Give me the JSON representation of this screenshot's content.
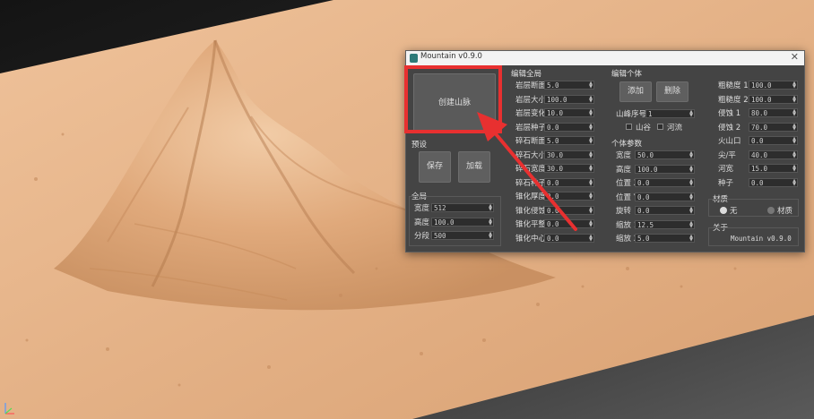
{
  "window": {
    "title": "Mountain v0.9.0",
    "close_glyph": "✕",
    "app_icon": "3ds-max-icon"
  },
  "create_button": {
    "label": "创建山脉"
  },
  "preset": {
    "header": "预设",
    "save_label": "保存",
    "load_label": "加载"
  },
  "global": {
    "header": "全局",
    "fields": [
      {
        "label": "宽度",
        "value": "512"
      },
      {
        "label": "高度",
        "value": "100.0"
      },
      {
        "label": "分段",
        "value": "500"
      }
    ]
  },
  "edit_global": {
    "header": "编辑全局",
    "fields": [
      {
        "label": "岩层断面",
        "value": "5.0"
      },
      {
        "label": "岩层大小",
        "value": "100.0"
      },
      {
        "label": "岩层变化",
        "value": "10.0"
      },
      {
        "label": "岩层种子",
        "value": "0.0"
      },
      {
        "label": "碎石断面",
        "value": "5.0"
      },
      {
        "label": "碎石大小",
        "value": "30.0"
      },
      {
        "label": "碎石宽度",
        "value": "30.0"
      },
      {
        "label": "碎石种子",
        "value": "0.0"
      },
      {
        "label": "锥化厚度",
        "value": "0.0"
      },
      {
        "label": "锥化侵蚀",
        "value": "0.0"
      },
      {
        "label": "锥化平整",
        "value": "0.0"
      },
      {
        "label": "锥化中心",
        "value": "0.0"
      }
    ]
  },
  "edit_individual": {
    "header": "编辑个体",
    "add_label": "添加",
    "delete_label": "删除",
    "peak_index_label": "山峰序号",
    "peak_index_value": "1",
    "valley_label": "山谷",
    "river_label": "河流"
  },
  "individual_params": {
    "header": "个体参数",
    "fields": [
      {
        "label": "宽度",
        "value": "50.0"
      },
      {
        "label": "高度",
        "value": "100.0"
      },
      {
        "label": "位置 X",
        "value": "0.0"
      },
      {
        "label": "位置 Y",
        "value": "0.0"
      },
      {
        "label": "旋转",
        "value": "0.0"
      },
      {
        "label": "缩放 1",
        "value": "12.5"
      },
      {
        "label": "缩放 2",
        "value": "5.0"
      }
    ]
  },
  "right_params": {
    "fields": [
      {
        "label": "粗糙度 1",
        "value": "100.0"
      },
      {
        "label": "粗糙度 2",
        "value": "100.0"
      },
      {
        "label": "侵蚀 1",
        "value": "80.0"
      },
      {
        "label": "侵蚀 2",
        "value": "70.0"
      },
      {
        "label": "火山口",
        "value": "0.0"
      },
      {
        "label": "尖/平",
        "value": "40.0"
      },
      {
        "label": "河宽",
        "value": "15.0"
      },
      {
        "label": "种子",
        "value": "0.0"
      }
    ]
  },
  "material": {
    "header": "材质",
    "option_none": "无",
    "option_material": "材质",
    "selected": "无"
  },
  "about": {
    "header": "关于",
    "text": "Mountain v0.9.0"
  },
  "colors": {
    "terrain": "#e2ae82",
    "annotation": "#e83030",
    "dialog_bg": "#444444"
  }
}
